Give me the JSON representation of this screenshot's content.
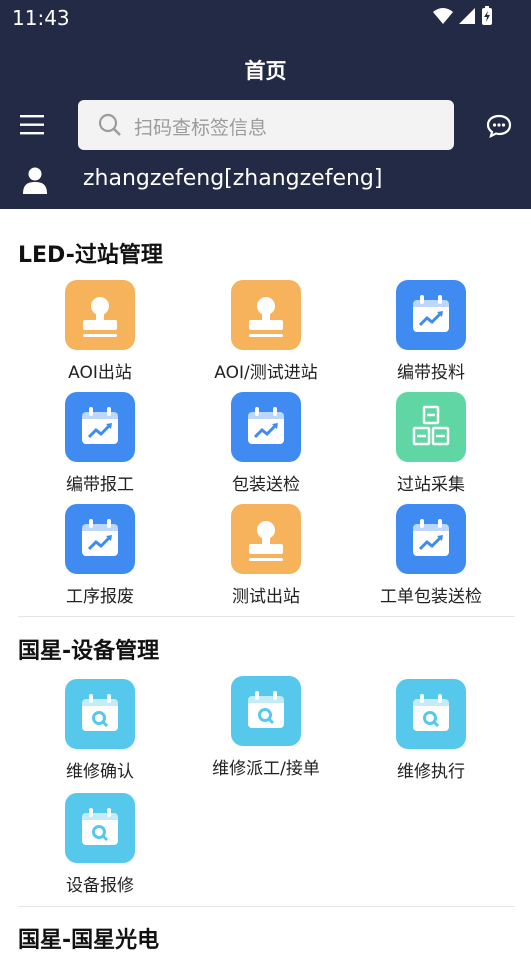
{
  "status": {
    "time": "11:43"
  },
  "header": {
    "title": "首页",
    "search_placeholder": "扫码查标签信息",
    "username": "zhangzefeng[zhangzefeng]"
  },
  "sections": [
    {
      "title": "LED-过站管理",
      "items": [
        {
          "label": "AOI出站",
          "icon": "stamp-icon",
          "color": "#f6b35c"
        },
        {
          "label": "AOI/测试进站",
          "icon": "stamp-icon",
          "color": "#f6b35c"
        },
        {
          "label": "编带投料",
          "icon": "calendar-chart-icon",
          "color": "#3f8bf2"
        },
        {
          "label": "编带报工",
          "icon": "calendar-chart-icon",
          "color": "#3f8bf2"
        },
        {
          "label": "包装送检",
          "icon": "calendar-chart-icon",
          "color": "#3f8bf2"
        },
        {
          "label": "过站采集",
          "icon": "boxes-icon",
          "color": "#5fd6a4"
        },
        {
          "label": "工序报废",
          "icon": "calendar-chart-icon",
          "color": "#3f8bf2"
        },
        {
          "label": "测试出站",
          "icon": "stamp-icon",
          "color": "#f6b35c"
        },
        {
          "label": "工单包装送检",
          "icon": "calendar-chart-icon",
          "color": "#3f8bf2"
        }
      ]
    },
    {
      "title": "国星-设备管理",
      "items": [
        {
          "label": "维修确认",
          "icon": "calendar-search-icon",
          "color": "#55c8ec"
        },
        {
          "label": "维修派工/接单",
          "icon": "calendar-search-icon",
          "color": "#55c8ec"
        },
        {
          "label": "维修执行",
          "icon": "calendar-search-icon",
          "color": "#55c8ec"
        },
        {
          "label": "设备报修",
          "icon": "calendar-search-icon",
          "color": "#55c8ec"
        }
      ]
    },
    {
      "title": "国星-国星光电",
      "items": []
    }
  ]
}
